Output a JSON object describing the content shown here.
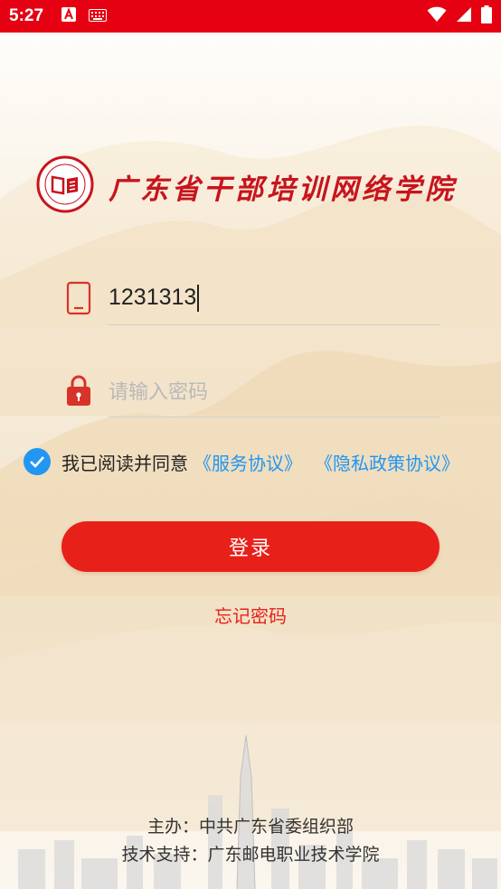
{
  "status_bar": {
    "time": "5:27",
    "icons": [
      "a-notification-icon",
      "keyboard-icon",
      "wifi-icon",
      "signal-icon",
      "battery-icon"
    ]
  },
  "logo": {
    "title": "广东省干部培训网络学院",
    "icon": "book-seal-logo"
  },
  "login_form": {
    "phone_value": "1231313",
    "phone_icon": "phone-icon",
    "password_placeholder": "请输入密码",
    "password_icon": "lock-icon"
  },
  "agreement": {
    "checked": true,
    "text": "我已阅读并同意",
    "service_link": "《服务协议》",
    "privacy_link": "《隐私政策协议》"
  },
  "actions": {
    "login_label": "登录",
    "forgot_label": "忘记密码"
  },
  "footer": {
    "sponsor": "主办：中共广东省委组织部",
    "support": "技术支持：广东邮电职业技术学院"
  },
  "colors": {
    "status_bar": "#e50012",
    "brand_red": "#c8141d",
    "button_red": "#e8201a",
    "link_blue": "#2196f3"
  }
}
